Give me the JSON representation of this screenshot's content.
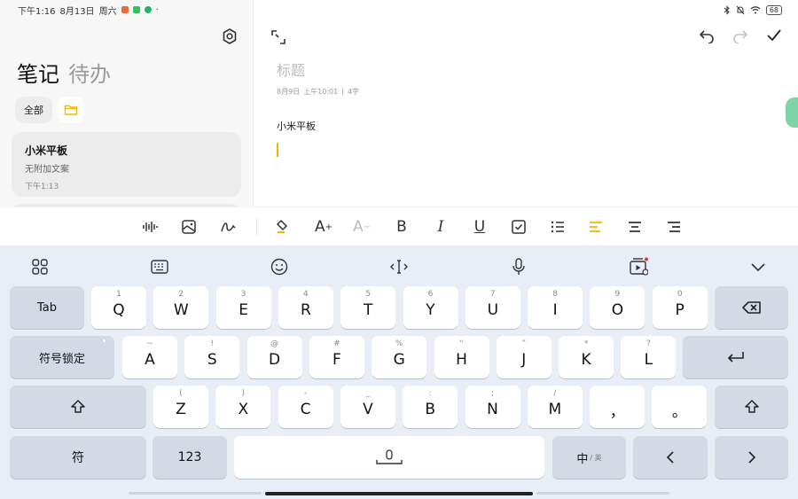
{
  "status_bar": {
    "time": "下午1:16",
    "date": "8月13日",
    "weekday": "周六",
    "notif_colors": [
      "#f06a3b",
      "#34c06b",
      "#29b36a"
    ],
    "battery": "68"
  },
  "sidebar": {
    "tabs": [
      {
        "label": "笔记"
      },
      {
        "label": "待办"
      }
    ],
    "filter_all": "全部",
    "folder_color": "#f5b400",
    "notes": [
      {
        "title": "小米平板",
        "subtitle": "无附加文案",
        "time": "下午1:13"
      }
    ]
  },
  "editor": {
    "title_placeholder": "标题",
    "date": "8月9日",
    "time": "上午10:01",
    "count": "4字",
    "body": "小米平板",
    "caret_color": "#f5b400"
  },
  "keyboard": {
    "row1": [
      {
        "hint": "1",
        "label": "Q"
      },
      {
        "hint": "2",
        "label": "W"
      },
      {
        "hint": "3",
        "label": "E"
      },
      {
        "hint": "4",
        "label": "R"
      },
      {
        "hint": "5",
        "label": "T"
      },
      {
        "hint": "6",
        "label": "Y"
      },
      {
        "hint": "7",
        "label": "U"
      },
      {
        "hint": "8",
        "label": "I"
      },
      {
        "hint": "9",
        "label": "O"
      },
      {
        "hint": "0",
        "label": "P"
      }
    ],
    "row2": [
      {
        "hint": "~",
        "label": "A"
      },
      {
        "hint": "!",
        "label": "S"
      },
      {
        "hint": "@",
        "label": "D"
      },
      {
        "hint": "#",
        "label": "F"
      },
      {
        "hint": "%",
        "label": "G"
      },
      {
        "hint": "“",
        "label": "H"
      },
      {
        "hint": "”",
        "label": "J"
      },
      {
        "hint": "*",
        "label": "K"
      },
      {
        "hint": "?",
        "label": "L"
      }
    ],
    "row3": [
      {
        "hint": "(",
        "label": "Z"
      },
      {
        "hint": ")",
        "label": "X"
      },
      {
        "hint": "-",
        "label": "C"
      },
      {
        "hint": "_",
        "label": "V"
      },
      {
        "hint": ":",
        "label": "B"
      },
      {
        "hint": ";",
        "label": "N"
      },
      {
        "hint": "/",
        "label": "M"
      },
      {
        "hint": "",
        "label": "，"
      },
      {
        "hint": "",
        "label": "。"
      }
    ],
    "tab_label": "Tab",
    "symbol_lock_label": "符号锁定",
    "symbol_label": "符",
    "num_label": "123",
    "lang_main": "中",
    "lang_sub": "/ 英",
    "accent_dot": "#e53935"
  }
}
